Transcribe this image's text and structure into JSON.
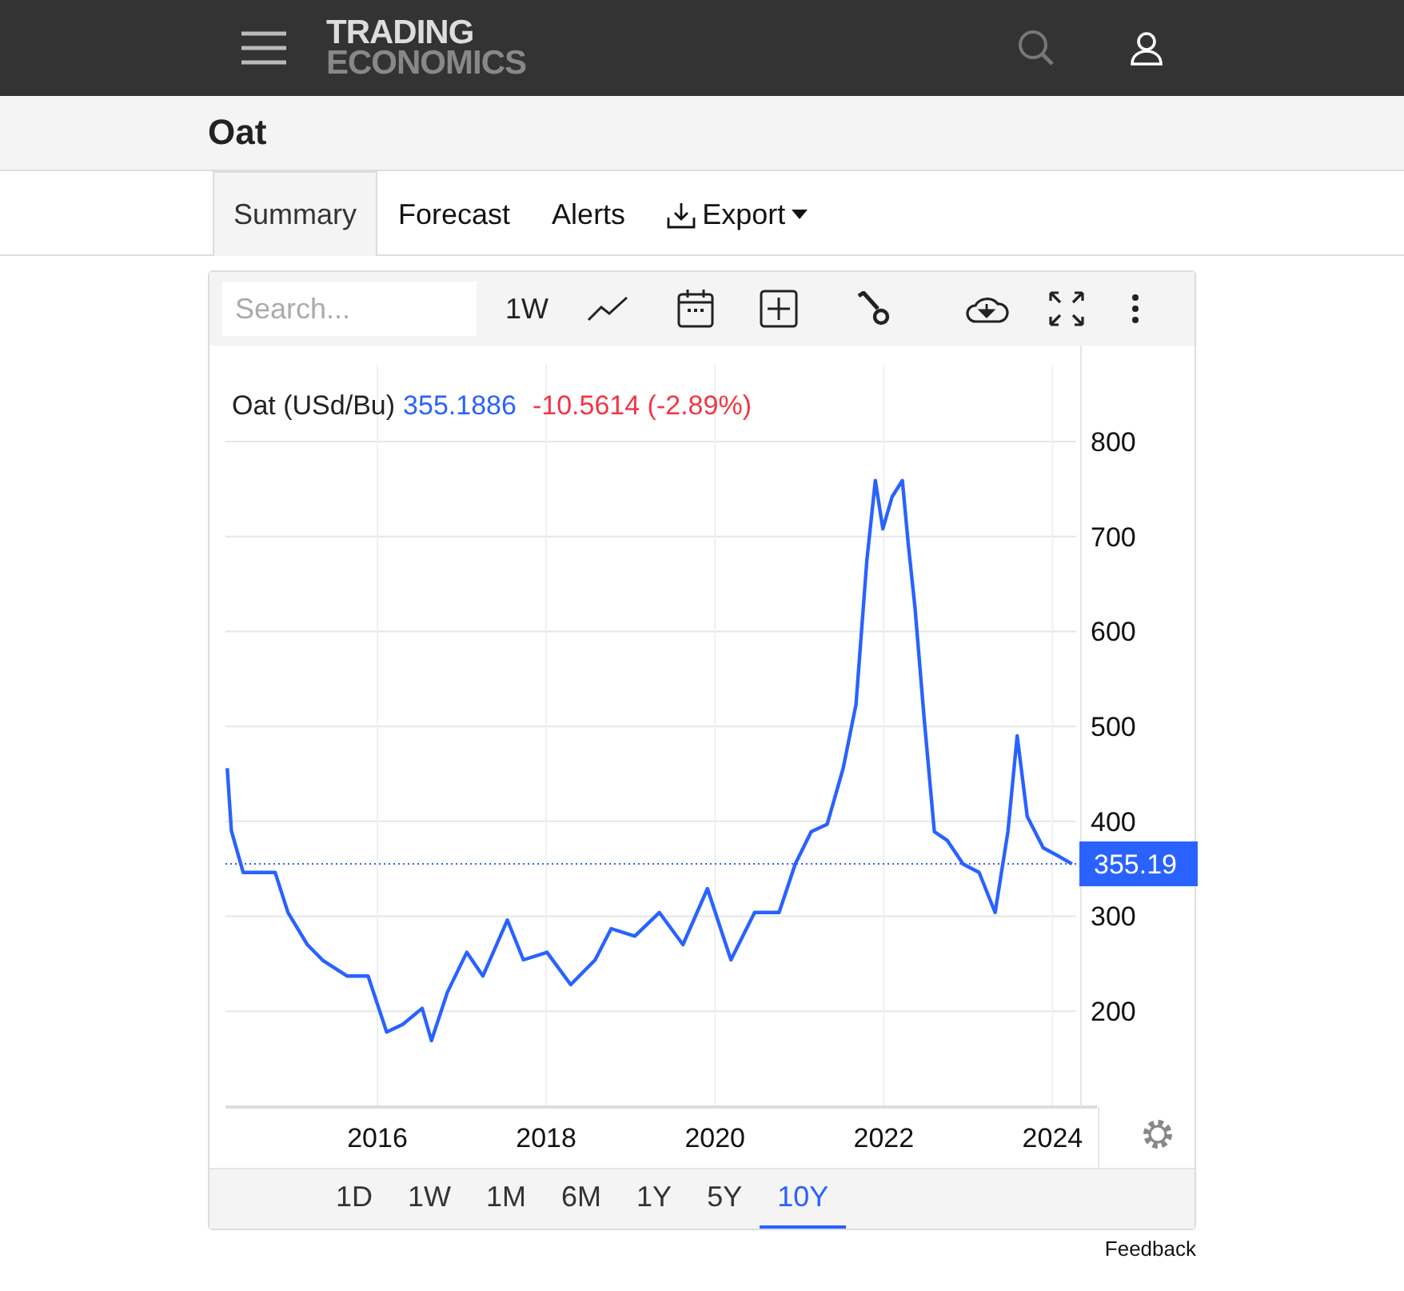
{
  "header": {
    "logo_top": "TRADING",
    "logo_bottom": "ECONOMICS"
  },
  "title": "Oat",
  "tabs": [
    {
      "label": "Summary",
      "selected": true,
      "kind": "plain"
    },
    {
      "label": "Forecast",
      "selected": false,
      "kind": "plain"
    },
    {
      "label": "Alerts",
      "selected": false,
      "kind": "plain"
    },
    {
      "label": "Export",
      "selected": false,
      "kind": "export"
    }
  ],
  "toolbar": {
    "search_placeholder": "Search...",
    "interval": "1W"
  },
  "chart": {
    "legend": {
      "name": "Oat (USd/Bu)",
      "last": "355.1886",
      "change": "-10.5614 (-2.89%)"
    },
    "chart_data": {
      "type": "line",
      "x": [
        2014.22,
        2014.27,
        2014.41,
        2014.6,
        2014.79,
        2014.94,
        2015.17,
        2015.36,
        2015.64,
        2015.89,
        2016.11,
        2016.3,
        2016.53,
        2016.64,
        2016.83,
        2017.06,
        2017.25,
        2017.54,
        2017.73,
        2018.01,
        2018.29,
        2018.58,
        2018.77,
        2019.05,
        2019.34,
        2019.62,
        2019.91,
        2020.19,
        2020.47,
        2020.76,
        2020.95,
        2021.14,
        2021.33,
        2021.52,
        2021.67,
        2021.8,
        2021.9,
        2021.99,
        2022.1,
        2022.22,
        2022.29,
        2022.37,
        2022.48,
        2022.6,
        2022.75,
        2022.94,
        2023.13,
        2023.32,
        2023.47,
        2023.58,
        2023.7,
        2023.89,
        2024.08,
        2024.23
      ],
      "grid": true,
      "ref_lines": [
        {
          "axis": "y",
          "value": 355.19,
          "label": "355.19",
          "color": "#2962ff"
        }
      ],
      "series": [
        {
          "color": "#2962ff",
          "values": [
            456,
            390,
            346,
            346,
            346,
            304,
            270,
            253,
            237,
            237,
            178,
            186,
            203,
            169,
            220,
            262,
            237,
            296,
            254,
            262,
            228,
            254,
            287,
            279,
            304,
            270,
            329,
            254,
            304,
            304,
            355,
            389,
            397,
            456,
            523,
            675,
            759,
            708,
            742,
            759,
            692,
            625,
            507,
            389,
            380,
            355,
            346,
            304,
            389,
            490,
            405,
            372,
            363,
            355
          ]
        }
      ],
      "xlim": [
        2014.2,
        2024.28
      ],
      "ylim": [
        99,
        881
      ],
      "xticks": [
        2016,
        2018,
        2020,
        2022,
        2024
      ],
      "yticks": [
        200,
        300,
        400,
        500,
        600,
        700,
        800
      ]
    }
  },
  "ranges": [
    {
      "label": "1D",
      "selected": false
    },
    {
      "label": "1W",
      "selected": false
    },
    {
      "label": "1M",
      "selected": false
    },
    {
      "label": "6M",
      "selected": false
    },
    {
      "label": "1Y",
      "selected": false
    },
    {
      "label": "5Y",
      "selected": false
    },
    {
      "label": "10Y",
      "selected": true
    }
  ],
  "feedback": "Feedback"
}
